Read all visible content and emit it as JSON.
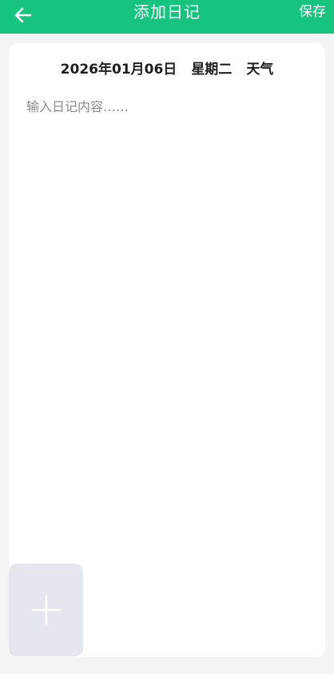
{
  "header": {
    "title": "添加日记",
    "save_label": "保存",
    "back_icon": "arrow-left-icon",
    "bg_color": "#16c37f"
  },
  "diary": {
    "date": "2026年01月06日",
    "weekday": "星期二",
    "weather_label": "天气",
    "content_placeholder": "输入日记内容……",
    "content_value": ""
  },
  "attachments": {
    "add_icon": "plus-icon"
  }
}
